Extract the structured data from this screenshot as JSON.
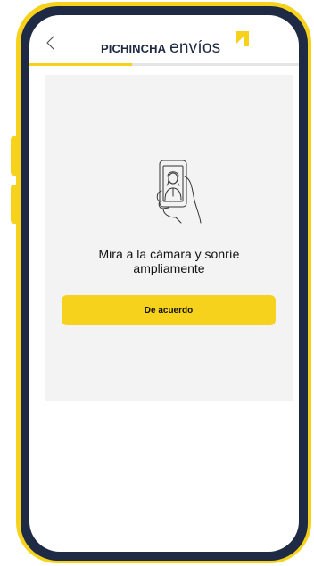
{
  "brand": {
    "name": "PICHINCHA",
    "product": "envíos"
  },
  "progress": {
    "fraction": 0.38
  },
  "step": {
    "message": "Mira a la cámara y sonríe ampliamente",
    "action_label": "De acuerdo"
  },
  "icons": {
    "back": "chevron-left-icon",
    "illustration": "selfie-phone-icon",
    "brand_mark": "brand-arrow-icon"
  },
  "colors": {
    "accent": "#f7d21c",
    "navy": "#1f2a44",
    "card_bg": "#f3f3f4",
    "track": "#e5e5e8"
  }
}
